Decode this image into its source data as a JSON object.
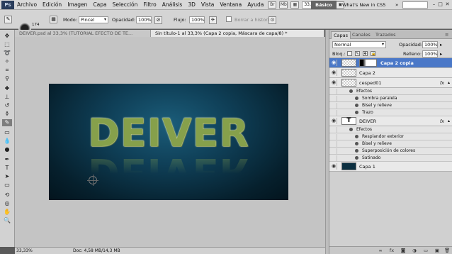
{
  "app": {
    "logo": "Ps",
    "menu": [
      "Archivo",
      "Edición",
      "Imagen",
      "Capa",
      "Selección",
      "Filtro",
      "Análisis",
      "3D",
      "Vista",
      "Ventana",
      "Ayuda"
    ],
    "zoom_box": "33,3",
    "workspace_active": "Básico",
    "workspace_link": "What's New in CS5",
    "workspace_more": "»"
  },
  "options": {
    "brush_size": "174",
    "mode_label": "Modo:",
    "mode_value": "Pincel",
    "opacity_label": "Opacidad:",
    "opacity_value": "100%",
    "flow_label": "Flujo:",
    "flow_value": "100%",
    "history_label": "Borrar a historia"
  },
  "tabs": [
    {
      "label": "DEIVER.psd al 33,3% (TUTORIAL EFECTO DE TE..."
    },
    {
      "label": "Sin título-1 al 33,3% (Capa 2 copia, Máscara de capa/8) *"
    }
  ],
  "canvas": {
    "artwork_text": "DEIVER"
  },
  "status": {
    "zoom": "33,33%",
    "doc": "Doc: 4,58 MB/14,3 MB"
  },
  "layers_panel": {
    "tabs": [
      "Capas",
      "Canales",
      "Trazados"
    ],
    "blend_mode": "Normal",
    "opacity_label": "Opacidad:",
    "opacity_value": "100%",
    "lock_label": "Bloq.:",
    "fill_label": "Relleno:",
    "fill_value": "100%",
    "layers": [
      {
        "name": "Capa 2 copia"
      },
      {
        "name": "Capa 2"
      },
      {
        "name": "cesped01",
        "fx": "fx"
      },
      {
        "name": "DEIVER",
        "fx": "fx",
        "thumb": "T"
      },
      {
        "name": "Capa 1"
      }
    ],
    "effects_cesped": [
      "Efectos",
      "Sombra paralela",
      "Bisel y relieve",
      "Trazo"
    ],
    "effects_deiver": [
      "Efectos",
      "Resplandor exterior",
      "Bisel y relieve",
      "Superposición de colores",
      "Satinado"
    ]
  }
}
